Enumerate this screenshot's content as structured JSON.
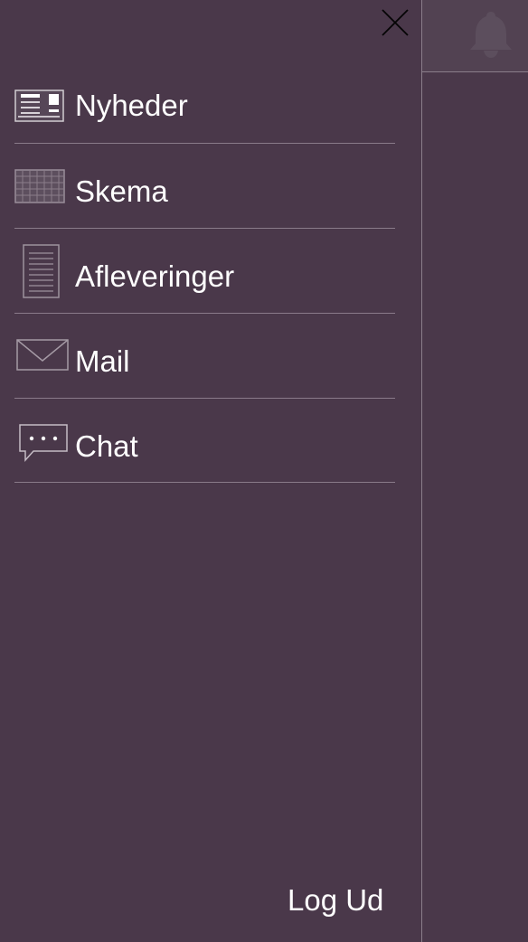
{
  "menu": {
    "items": [
      {
        "label": "Nyheder",
        "icon": "news-icon"
      },
      {
        "label": "Skema",
        "icon": "calendar-icon"
      },
      {
        "label": "Afleveringer",
        "icon": "document-icon"
      },
      {
        "label": "Mail",
        "icon": "envelope-icon"
      },
      {
        "label": "Chat",
        "icon": "chat-bubble-icon"
      }
    ]
  },
  "footer": {
    "logout_label": "Log Ud"
  },
  "header": {
    "close_icon": "close-icon",
    "notification_icon": "bell-icon"
  },
  "colors": {
    "background": "#4a384a",
    "text": "#ffffff",
    "divider": "#8a7b8a"
  }
}
